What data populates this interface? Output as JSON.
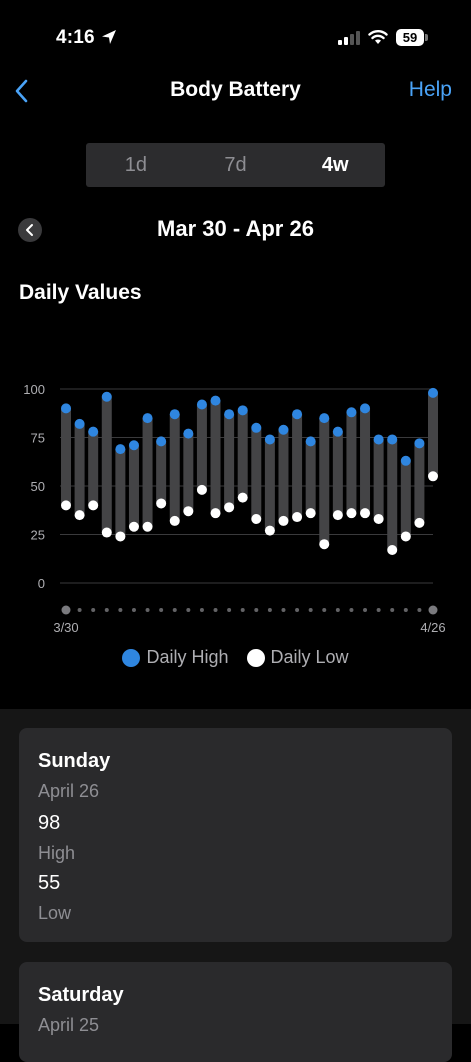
{
  "status": {
    "time": "4:16",
    "battery": "59"
  },
  "nav": {
    "title": "Body Battery",
    "help": "Help"
  },
  "tabs": [
    {
      "label": "1d"
    },
    {
      "label": "7d"
    },
    {
      "label": "4w"
    }
  ],
  "selected_tab": "4w",
  "date_range": "Mar 30 - Apr 26",
  "section_title": "Daily Values",
  "colors": {
    "high": "#2f86e0",
    "low": "#ffffff",
    "bar": "#444446",
    "accent": "#4aa3f7"
  },
  "chart_data": {
    "type": "bar",
    "x_labels": [
      "3/30",
      "4/26"
    ],
    "y_ticks": [
      "100",
      "75",
      "50",
      "25",
      "0"
    ],
    "ylim": [
      0,
      100
    ],
    "grid": true,
    "legend_position": "bottom",
    "series": [
      {
        "name": "Daily High",
        "values": [
          90,
          82,
          78,
          96,
          69,
          71,
          85,
          73,
          87,
          77,
          92,
          94,
          87,
          89,
          80,
          74,
          79,
          87,
          73,
          85,
          78,
          88,
          90,
          74,
          74,
          63,
          72,
          98
        ]
      },
      {
        "name": "Daily Low",
        "values": [
          40,
          35,
          40,
          26,
          24,
          29,
          29,
          41,
          32,
          37,
          48,
          36,
          39,
          44,
          33,
          27,
          32,
          34,
          36,
          20,
          35,
          36,
          36,
          33,
          17,
          24,
          31,
          55
        ]
      }
    ]
  },
  "cards": [
    {
      "day": "Sunday",
      "date": "April 26",
      "high": "98",
      "high_label": "High",
      "low": "55",
      "low_label": "Low"
    },
    {
      "day": "Saturday",
      "date": "April 25"
    }
  ]
}
